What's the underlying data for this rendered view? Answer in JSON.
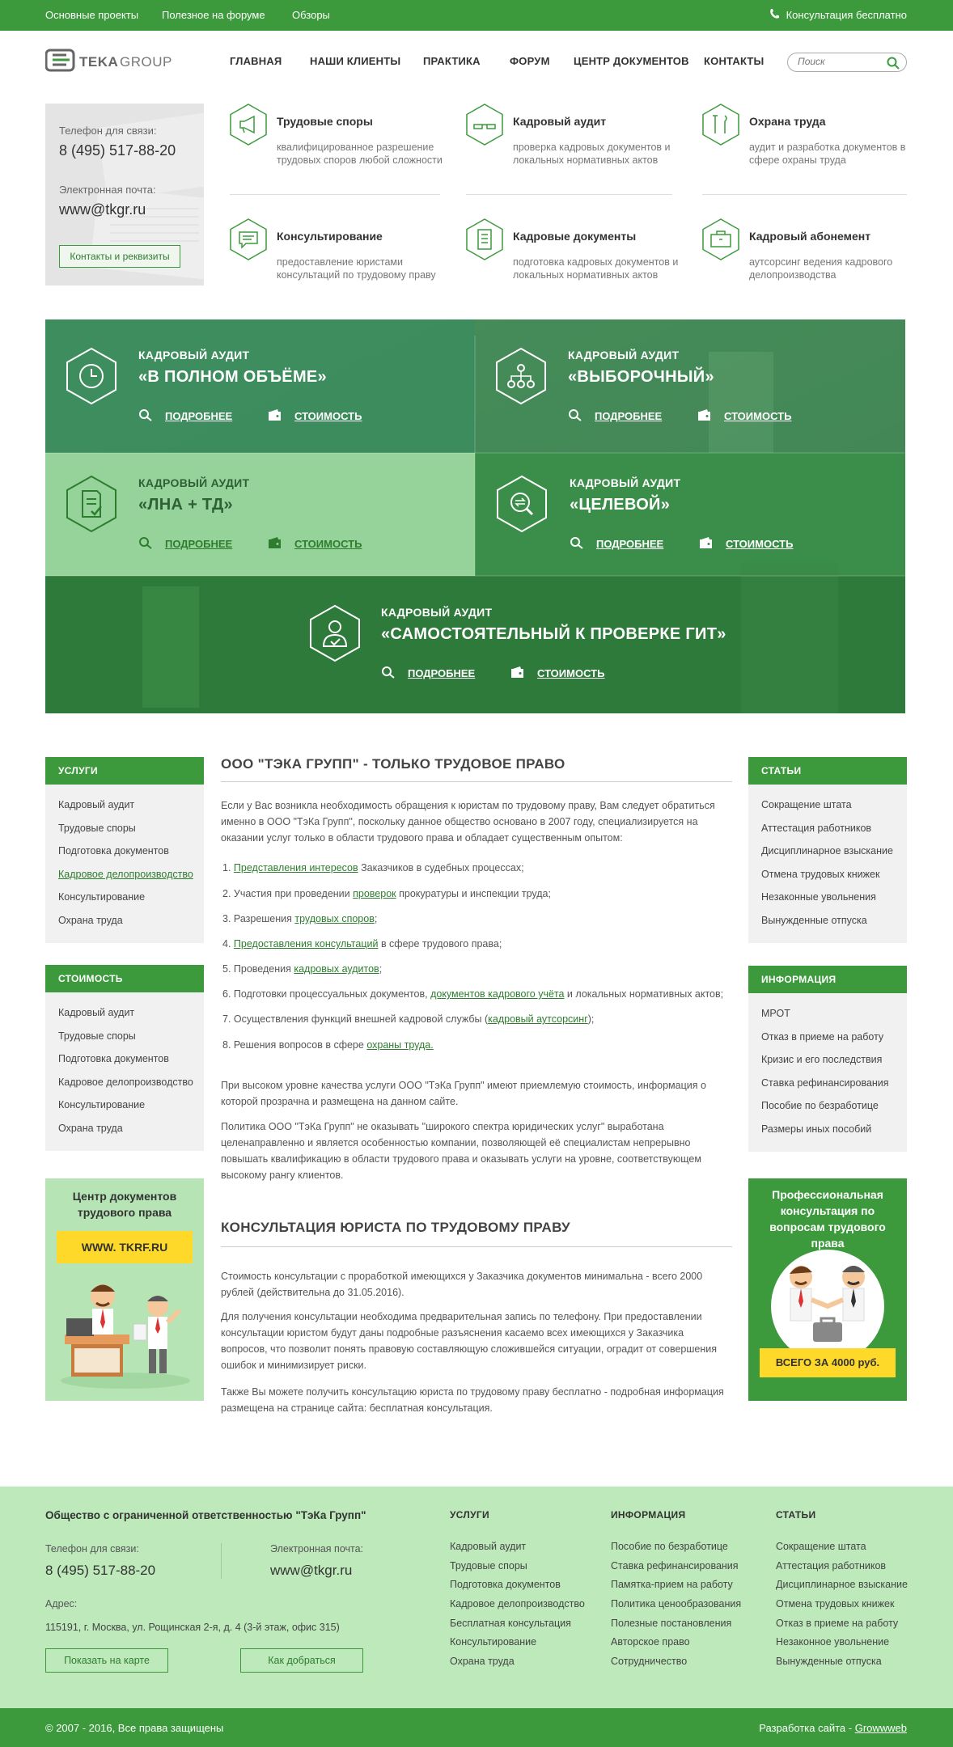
{
  "topbar": {
    "links": [
      "Основные проекты",
      "Полезное на форуме",
      "Обзоры"
    ],
    "consult": "Консультация бесплатно"
  },
  "header": {
    "logo_text": "TEKAGROUP",
    "nav": [
      "ГЛАВНАЯ",
      "НАШИ КЛИЕНТЫ",
      "ПРАКТИКА",
      "ФОРУМ",
      "ЦЕНТР ДОКУМЕНТОВ",
      "КОНТАКТЫ"
    ],
    "search_placeholder": "Поиск"
  },
  "contact_card": {
    "phone_label": "Телефон для связи:",
    "phone": "8 (495) 517-88-20",
    "email_label": "Электронная почта:",
    "email": "www@tkgr.ru",
    "button": "Контакты и реквизиты"
  },
  "services": [
    {
      "title": "Трудовые споры",
      "desc": "квалифицированное разрешение трудовых споров любой сложности",
      "icon": "megaphone-icon"
    },
    {
      "title": "Кадровый аудит",
      "desc": "проверка кадровых документов и локальных нормативных актов",
      "icon": "glasses-icon"
    },
    {
      "title": "Охрана труда",
      "desc": "аудит и разработка документов в сфере охраны труда",
      "icon": "tools-icon"
    },
    {
      "title": "Консультирование",
      "desc": "предоставление юристами консультаций по трудовому праву",
      "icon": "chat-icon"
    },
    {
      "title": "Кадровые документы",
      "desc": "подготовка кадровых документов и локальных нормативных актов",
      "icon": "document-icon"
    },
    {
      "title": "Кадровый абонемент",
      "desc": "аутсорсинг ведения кадрового делопроизводства",
      "icon": "briefcase-icon"
    }
  ],
  "audits": {
    "tag": "КАДРОВЫЙ АУДИТ",
    "more": "ПОДРОБНЕЕ",
    "price": "СТОИМОСТЬ",
    "items": [
      {
        "title": "«В ПОЛНОМ ОБЪЁМЕ»",
        "icon": "clock-icon"
      },
      {
        "title": "«ВЫБОРОЧНЫЙ»",
        "icon": "hierarchy-icon"
      },
      {
        "title": "«ЛНА + ТД»",
        "icon": "checklist-icon"
      },
      {
        "title": "«ЦЕЛЕВОЙ»",
        "icon": "target-search-icon"
      },
      {
        "title": "«САМОСТОЯТЕЛЬНЫЙ К ПРОВЕРКЕ ГИТ»",
        "icon": "user-check-icon"
      }
    ]
  },
  "sidebar_left": {
    "services_title": "УСЛУГИ",
    "services": [
      "Кадровый аудит",
      "Трудовые споры",
      "Подготовка документов",
      "Кадровое делопроизводство",
      "Консультирование",
      "Охрана труда"
    ],
    "prices_title": "СТОИМОСТЬ",
    "prices": [
      "Кадровый аудит",
      "Трудовые споры",
      "Подготовка документов",
      "Кадровое делопроизводство",
      "Консультирование",
      "Охрана труда"
    ],
    "promo_title": "Центр документов трудового права",
    "promo_site": "WWW. TKRF.RU"
  },
  "sidebar_right": {
    "articles_title": "СТАТЬИ",
    "articles": [
      "Сокращение штата",
      "Аттестация работников",
      "Дисциплинарное взыскание",
      "Отмена трудовых книжек",
      "Незаконные увольнения",
      "Вынужденные отпуска"
    ],
    "info_title": "ИНФОРМАЦИЯ",
    "info": [
      "МРОТ",
      "Отказ в приеме на работу",
      "Кризис и его последствия",
      "Ставка рефинансирования",
      "Пособие по безработице",
      "Размеры иных пособий"
    ],
    "promo_title": "Профессиональная консультация по вопросам трудового права",
    "promo_price": "ВСЕГО ЗА 4000 руб."
  },
  "main": {
    "h1": "ООО \"ТЭКА ГРУПП\" - ТОЛЬКО ТРУДОВОЕ ПРАВО",
    "intro": "Если у Вас возникла необходимость обращения к юристам по трудовому праву, Вам следует обратиться именно в ООО \"ТэКа Групп\", поскольку данное общество основано в 2007 году, специализируется на оказании услуг только в области трудового права и обладает существенным опытом:",
    "list": [
      {
        "pre": "1. ",
        "link": "Представления интересов",
        "post": " Заказчиков в судебных процессах;"
      },
      {
        "pre": "2. Участия при проведении ",
        "link": "проверок",
        "post": " прокуратуры и инспекции труда;"
      },
      {
        "pre": "3. Разрешения ",
        "link": "трудовых споров",
        "post": ";"
      },
      {
        "pre": "4. ",
        "link": "Предоставления консультаций",
        "post": " в сфере трудового права;"
      },
      {
        "pre": "5. Проведения ",
        "link": "кадровых аудитов",
        "post": ";"
      },
      {
        "pre": "6. Подготовки процессуальных документов, ",
        "link": "документов кадрового учёта",
        "post": " и локальных нормативных актов;"
      },
      {
        "pre": "7. Осуществления функций внешней кадровой службы (",
        "link": "кадровый аутсорсинг",
        "post": ");"
      },
      {
        "pre": "8. Решения вопросов в сфере ",
        "link": "охраны труда.",
        "post": ""
      }
    ],
    "p2": "При высоком уровне качества услуги ООО \"ТэКа Групп\" имеют приемлемую стоимость, информация о которой прозрачна и размещена на данном сайте.",
    "p3": "Политика ООО \"ТэКа Групп\" не оказывать \"широкого спектра юридических услуг\" выработана целенаправленно и является особенностью компании, позволяющей её специалистам непрерывно повышать квалификацию в области трудового права и оказывать услуги на уровне, соответствующем высокому рангу клиентов.",
    "h2": "КОНСУЛЬТАЦИЯ ЮРИСТА ПО ТРУДОВОМУ ПРАВУ",
    "p4": "Стоимость консультации с проработкой имеющихся у Заказчика документов минимальна - всего 2000 рублей (действительна до 31.05.2016).",
    "p5": "Для получения консультации необходима предварительная запись по телефону. При предоставлении консультации юристом будут даны подробные разъяснения касаемо всех имеющихся у Заказчика вопросов, что позволит понять правовую составляющую сложившейся ситуации, оградит от совершения ошибок и минимизирует риски.",
    "p6": "Также Вы можете получить консультацию юриста по трудовому праву бесплатно - подробная информация размещена на странице сайта: бесплатная консультация."
  },
  "footer": {
    "company": "Общество с ограниченной ответственностью \"ТэКа Групп\"",
    "phone_label": "Телефон для связи:",
    "phone": "8 (495) 517-88-20",
    "email_label": "Электронная почта:",
    "email": "www@tkgr.ru",
    "address_label": "Адрес:",
    "address": "115191, г. Москва, ул. Рощинская 2-я, д. 4 (3-й этаж, офис 315)",
    "btn_map": "Показать на карте",
    "btn_route": "Как добраться",
    "col1_title": "УСЛУГИ",
    "col1": [
      "Кадровый аудит",
      "Трудовые споры",
      "Подготовка документов",
      "Кадровое делопроизводство",
      "Бесплатная консультация",
      "Консультирование",
      "Охрана труда"
    ],
    "col2_title": "ИНФОРМАЦИЯ",
    "col2": [
      "Пособие по безработице",
      "Ставка рефинансирования",
      "Памятка-прием на работу",
      "Политика ценообразования",
      "Полезные постановления",
      "Авторское право",
      "Сотрудничество"
    ],
    "col3_title": "СТАТЬИ",
    "col3": [
      "Сокращение штата",
      "Аттестация работников",
      "Дисциплинарное взыскание",
      "Отмена трудовых книжек",
      "Отказ в приеме на работу",
      "Незаконное увольнение",
      "Вынужденные отпуска"
    ],
    "copyright": "© 2007 - 2016, Все права защищены",
    "dev_label": "Разработка сайта - ",
    "dev_link": "Growwweb"
  },
  "colors": {
    "green": "#3c9a3c",
    "light_green": "#bde9bb",
    "yellow": "#ffd92a"
  }
}
